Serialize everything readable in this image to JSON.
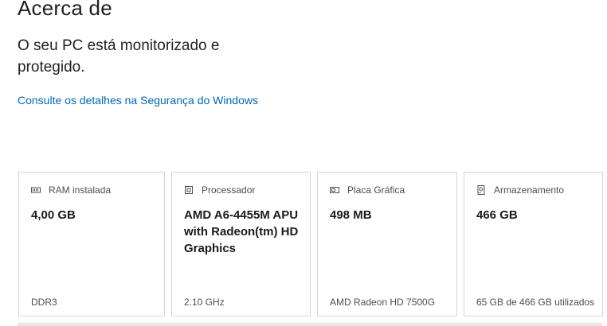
{
  "page": {
    "title": "Acerca de",
    "status_text": "O seu PC está monitorizado e protegido.",
    "security_link": "Consulte os detalhes na Segurança do Windows"
  },
  "cards": [
    {
      "label": "RAM instalada",
      "icon": "memory-icon",
      "value": "4,00 GB",
      "footer": "DDR3"
    },
    {
      "label": "Processador",
      "icon": "processor-icon",
      "value": "AMD A6-4455M APU with Radeon(tm) HD Graphics",
      "footer": "2.10 GHz"
    },
    {
      "label": "Placa Gráfica",
      "icon": "graphics-card-icon",
      "value": "498 MB",
      "footer": "AMD Radeon HD 7500G"
    },
    {
      "label": "Armazenamento",
      "icon": "storage-icon",
      "value": "466 GB",
      "footer": "65 GB de 466 GB utilizados"
    }
  ],
  "colors": {
    "link": "#0067b8",
    "card_border": "#d6d6d6",
    "muted_text": "#4d4d4d"
  }
}
